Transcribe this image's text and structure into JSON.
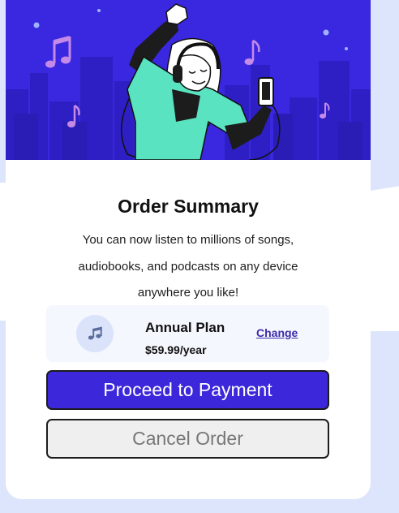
{
  "order": {
    "title": "Order Summary",
    "description": "You can now listen to millions of songs, audiobooks, and podcasts on any device anywhere you like!"
  },
  "plan": {
    "icon": "music-note-icon",
    "name": "Annual Plan",
    "price": "$59.99/year",
    "change_label": "Change"
  },
  "actions": {
    "proceed_label": "Proceed to Payment",
    "cancel_label": "Cancel Order"
  },
  "colors": {
    "hero_background": "#3a28e0",
    "primary_button": "#3c27db",
    "link": "#3b2aa9",
    "page_background": "#dde5fc"
  }
}
